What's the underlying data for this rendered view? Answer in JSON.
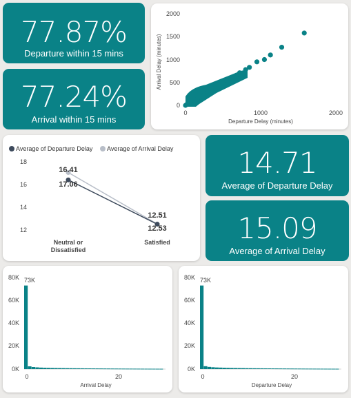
{
  "kpis": {
    "dep_within": {
      "value": "77.87%",
      "label": "Departure within 15 mins"
    },
    "arr_within": {
      "value": "77.24%",
      "label": "Arrival within 15 mins"
    },
    "avg_dep": {
      "value": "14.71",
      "label": "Average of Departure Delay"
    },
    "avg_arr": {
      "value": "15.09",
      "label": "Average of Arrival Delay"
    }
  },
  "colors": {
    "teal": "#0a8287",
    "dark_series": "#3d4a5c",
    "light_series": "#b8bec8"
  },
  "chart_data": [
    {
      "type": "scatter",
      "xlabel": "Departure Delay (minutes)",
      "ylabel": "Arrival Delay (minutes)",
      "xlim": [
        0,
        2000
      ],
      "ylim": [
        0,
        2000
      ],
      "x_ticks": [
        "0",
        "1000",
        "2000"
      ],
      "y_ticks": [
        "0",
        "500",
        "1000",
        "1500",
        "2000"
      ],
      "points": [
        [
          0,
          0
        ],
        [
          20,
          25
        ],
        [
          50,
          40
        ],
        [
          80,
          70
        ],
        [
          120,
          110
        ],
        [
          160,
          150
        ],
        [
          200,
          190
        ],
        [
          250,
          230
        ],
        [
          300,
          290
        ],
        [
          350,
          330
        ],
        [
          400,
          380
        ],
        [
          450,
          440
        ],
        [
          500,
          480
        ],
        [
          560,
          540
        ],
        [
          620,
          600
        ],
        [
          680,
          660
        ],
        [
          720,
          710
        ],
        [
          800,
          780
        ],
        [
          850,
          830
        ],
        [
          950,
          950
        ],
        [
          1050,
          1000
        ],
        [
          1130,
          1100
        ],
        [
          1280,
          1270
        ],
        [
          1580,
          1580
        ]
      ]
    },
    {
      "type": "line",
      "categories": [
        "Neutral or Dissatisfied",
        "Satisfied"
      ],
      "series": [
        {
          "name": "Average of Departure Delay",
          "values": [
            16.41,
            12.51
          ]
        },
        {
          "name": "Average of Arrival Delay",
          "values": [
            17.06,
            12.53
          ]
        }
      ],
      "ylim": [
        12,
        18
      ],
      "y_ticks": [
        "12",
        "14",
        "16",
        "18"
      ],
      "data_labels": [
        "16.41",
        "17.06",
        "12.51",
        "12.53"
      ]
    },
    {
      "type": "bar",
      "xlabel": "Arrival Delay",
      "x_ticks": [
        "0",
        "20"
      ],
      "y_ticks": [
        "0K",
        "20K",
        "40K",
        "60K",
        "80K"
      ],
      "ylim": [
        0,
        80000
      ],
      "values": [
        73000,
        2400,
        1800,
        1500,
        1300,
        1200,
        1100,
        1000,
        950,
        900,
        850,
        800,
        760,
        720,
        690,
        660,
        630,
        600,
        580,
        560,
        540,
        520,
        500,
        480,
        460,
        440,
        420,
        400,
        385,
        370,
        355,
        340,
        325,
        310,
        300,
        290,
        280
      ],
      "data_label": "73K"
    },
    {
      "type": "bar",
      "xlabel": "Departure Delay",
      "x_ticks": [
        "0",
        "20"
      ],
      "y_ticks": [
        "0K",
        "20K",
        "40K",
        "60K",
        "80K"
      ],
      "ylim": [
        0,
        80000
      ],
      "values": [
        73000,
        2500,
        1900,
        1600,
        1400,
        1300,
        1200,
        1100,
        1000,
        950,
        900,
        850,
        800,
        760,
        720,
        690,
        660,
        630,
        600,
        580,
        560,
        540,
        520,
        500,
        480,
        460,
        440,
        420,
        400,
        385,
        370,
        355,
        340,
        325,
        310,
        300,
        290
      ],
      "data_label": "73K"
    }
  ]
}
